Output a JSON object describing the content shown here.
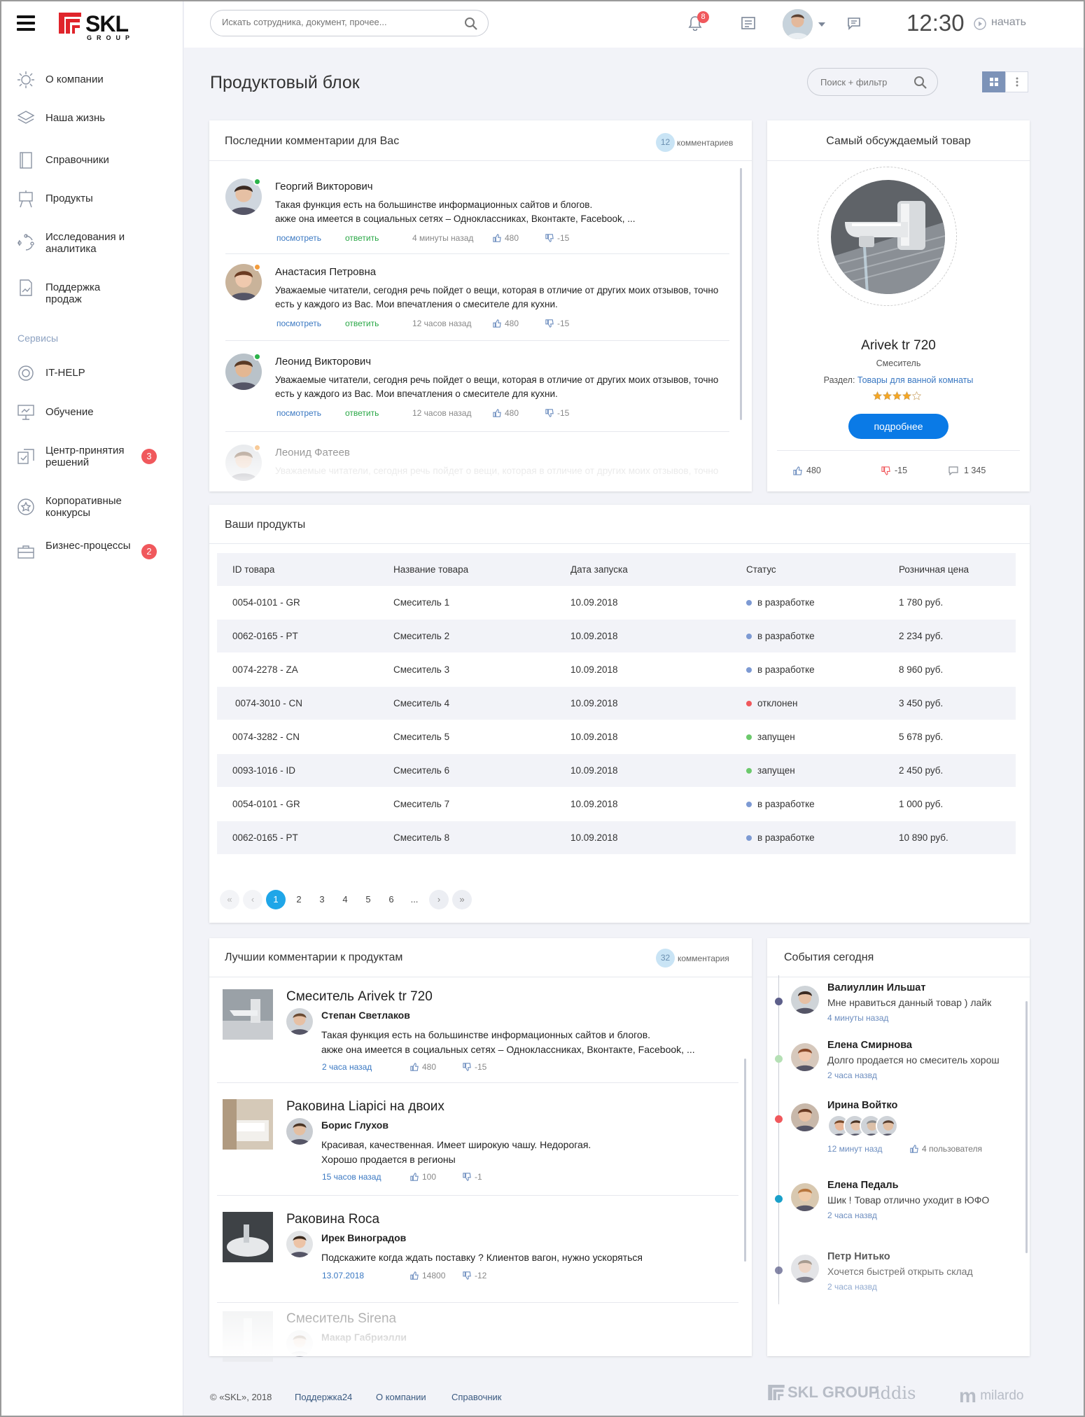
{
  "app": {
    "brand": "SKL",
    "brand_sub": "GROUP"
  },
  "sidebar": {
    "items": [
      {
        "label": "О компании",
        "icon": "sun-icon"
      },
      {
        "label": "Наша жизнь",
        "icon": "layers-icon"
      },
      {
        "label": "Справочники",
        "icon": "book-icon"
      },
      {
        "label": "Продукты",
        "icon": "easel-icon"
      },
      {
        "label": "Исследования и аналитика",
        "icon": "cycle-icon"
      },
      {
        "label": "Поддержка продаж",
        "icon": "chart-doc-icon"
      }
    ],
    "section_label": "Сервисы",
    "services": [
      {
        "label": "IT-HELP",
        "icon": "lifebuoy-icon"
      },
      {
        "label": "Обучение",
        "icon": "presentation-icon"
      },
      {
        "label": "Центр-принятия решений",
        "icon": "decision-icon",
        "badge": "3"
      },
      {
        "label": "Корпоративные конкурсы",
        "icon": "star-badge-icon"
      },
      {
        "label": "Бизнес-процессы",
        "icon": "briefcase-icon",
        "badge": "2"
      }
    ]
  },
  "header": {
    "search_placeholder": "Искать сотрудника, документ, прочее...",
    "notifications_count": "8",
    "time": "12:30",
    "start_label": "начать"
  },
  "page": {
    "title": "Продуктовый блок",
    "filter_placeholder": "Поиск + фильтр"
  },
  "recent_comments": {
    "title": "Последнии комментарии для Вас",
    "count": "12",
    "count_label": "комментариев",
    "items": [
      {
        "name": "Георгий Викторович",
        "line1": "Такая функция есть на большинстве информационных сайтов и блогов.",
        "line2": "акже она имеется в социальных сетях – Одноклассниках, Вконтакте, Facebook, ...",
        "view": "посмотреть",
        "reply": "ответить",
        "time": "4 минуты назад",
        "likes": "480",
        "dislikes": "-15",
        "status": "online"
      },
      {
        "name": "Анастасия Петровна",
        "line1": "Уважаемые читатели, сегодня речь пойдет о вещи, которая в отличие от других моих отзывов, точно",
        "line2": "есть у каждого из Вас.  Мои впечатления о смесителе для кухни.",
        "view": "посмотреть",
        "reply": "ответить",
        "time": "12 часов назад",
        "likes": "480",
        "dislikes": "-15",
        "status": "away"
      },
      {
        "name": "Леонид Викторович",
        "line1": "Уважаемые читатели, сегодня речь пойдет о вещи, которая в отличие от других моих отзывов, точно",
        "line2": "есть у каждого из Вас.  Мои впечатления о смесителе для кухни.",
        "view": "посмотреть",
        "reply": "ответить",
        "time": "12 часов назад",
        "likes": "480",
        "dislikes": "-15",
        "status": "online"
      },
      {
        "name": "Леонид Фатеев",
        "line1": "Уважаемые читатели, сегодня речь пойдет о вещи, которая в отличие от других моих отзывов, точно",
        "status": "away"
      }
    ]
  },
  "top_product": {
    "title": "Самый обсуждаемый товар",
    "name": "Arivek tr 720",
    "type": "Смеситель",
    "section_label": "Раздел:",
    "section_link": "Товары для ванной комнаты",
    "rating": 4,
    "rating_max": 5,
    "button": "подробнее",
    "likes": "480",
    "dislikes": "-15",
    "comments": "1 345"
  },
  "products": {
    "title": "Ваши продукты",
    "columns": [
      "ID товара",
      "Название товара",
      "Дата запуска",
      "Статус",
      "Розничная цена"
    ],
    "rows": [
      {
        "id": "0054-0101 - GR",
        "name": "Смеситель 1",
        "date": "10.09.2018",
        "status": "в разработке",
        "color": "#7d9ad3",
        "price": "1 780 руб."
      },
      {
        "id": "0062-0165 - PT",
        "name": "Смеситель 2",
        "date": "10.09.2018",
        "status": "в разработке",
        "color": "#7d9ad3",
        "price": "2 234 руб."
      },
      {
        "id": "0074-2278 - ZA",
        "name": "Смеситель 3",
        "date": "10.09.2018",
        "status": "в разработке",
        "color": "#7d9ad3",
        "price": "8 960 руб."
      },
      {
        "id": "0074-3010 - CN",
        "name": "Смеситель 4",
        "date": "10.09.2018",
        "status": "отклонен",
        "color": "#f0585c",
        "price": "3 450 руб."
      },
      {
        "id": "0074-3282 - CN",
        "name": "Смеситель 5",
        "date": "10.09.2018",
        "status": "запущен",
        "color": "#6cc96c",
        "price": "5 678 руб."
      },
      {
        "id": "0093-1016 - ID",
        "name": "Смеситель 6",
        "date": "10.09.2018",
        "status": "запущен",
        "color": "#6cc96c",
        "price": "2 450 руб."
      },
      {
        "id": "0054-0101 - GR",
        "name": "Смеситель 7",
        "date": "10.09.2018",
        "status": "в разработке",
        "color": "#7d9ad3",
        "price": "1 000 руб."
      },
      {
        "id": "0062-0165 - PT",
        "name": "Смеситель 8",
        "date": "10.09.2018",
        "status": "в разработке",
        "color": "#7d9ad3",
        "price": "10 890 руб."
      }
    ],
    "pages": [
      "1",
      "2",
      "3",
      "4",
      "5",
      "6",
      "..."
    ],
    "current_page": "1"
  },
  "best_comments": {
    "title": "Лучшии комментарии к продуктам",
    "count": "32",
    "count_label": "комментария",
    "items": [
      {
        "product": "Смеситель Arivek tr 720",
        "author": "Степан Светлаков",
        "line1": "Такая функция есть на большинстве информационных сайтов и блогов.",
        "line2": "акже она имеется в социальных сетях – Одноклассниках, Вконтакте, Facebook, ...",
        "time": "2 часа назад",
        "likes": "480",
        "dislikes": "-15"
      },
      {
        "product": "Раковина Liapici на двоих",
        "author": "Борис Глухов",
        "line1": "Красивая, качественная. Имеет широкую чашу. Недорогая.",
        "line2": "Хорошо продается в регионы",
        "time": "15 часов назад",
        "likes": "100",
        "dislikes": "-1"
      },
      {
        "product": "Раковина Roca",
        "author": "Ирек Виноградов",
        "line1": "Подскажите когда ждать поставку ? Клиентов вагон, нужно ускоряться",
        "line2": "",
        "time": "13.07.2018",
        "likes": "14800",
        "dislikes": "-12"
      },
      {
        "product": "Смеситель Sirena",
        "author": "Макар Габриэлли",
        "line1": "",
        "line2": ""
      }
    ]
  },
  "events": {
    "title": "События сегодня",
    "items": [
      {
        "name": "Валиуллин Ильшат",
        "text": "Мне нравиться данный товар ) лайк",
        "time": "4 минуты назад",
        "color": "#5d5f8a"
      },
      {
        "name": "Елена Смирнова",
        "text": "Долго продается но смеситель хорош",
        "time": "2 часа назвд",
        "color": "#b5e0b5"
      },
      {
        "name": "Ирина Войтко",
        "text": "",
        "time": "12 минут назд",
        "users": "4 пользователя",
        "color": "#f0585c"
      },
      {
        "name": "Елена Педаль",
        "text": "Шик ! Товар отлично уходит в ЮФО",
        "time": "2 часа назвд",
        "color": "#1aa0c9"
      },
      {
        "name": "Петр Нитько",
        "text": "Хочется быстрей открыть склад",
        "time": "2 часа назвд",
        "color": "#5d5f8a"
      }
    ]
  },
  "footer": {
    "copyright": "© «SKL», 2018",
    "links": [
      "Поддержка24",
      "О компании",
      "Справочник"
    ],
    "partners": [
      "SKL GROUP",
      "iddis",
      "milardo"
    ]
  }
}
